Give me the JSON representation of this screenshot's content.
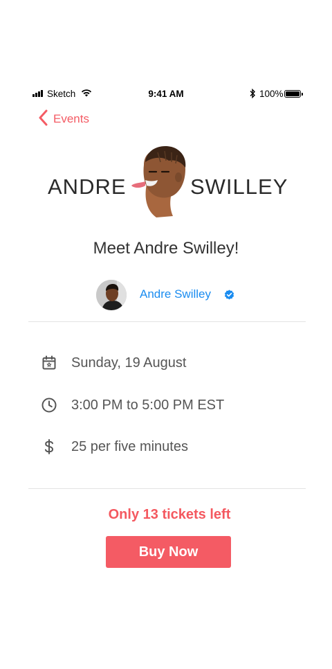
{
  "status_bar": {
    "carrier": "Sketch",
    "time": "9:41 AM",
    "battery_percent": "100%"
  },
  "nav": {
    "back_label": "Events"
  },
  "header": {
    "brand_first": "ANDRE",
    "brand_last": "SWILLEY"
  },
  "event": {
    "title": "Meet Andre Swilley!",
    "host_name": "Andre Swilley",
    "date": "Sunday, 19 August",
    "time": "3:00 PM to 5:00 PM EST",
    "price": "25 per five minutes"
  },
  "purchase": {
    "tickets_left": "Only 13 tickets left",
    "buy_label": "Buy Now"
  },
  "colors": {
    "accent": "#f45b64",
    "link": "#1a8cf0",
    "verified": "#1a8cf0"
  }
}
